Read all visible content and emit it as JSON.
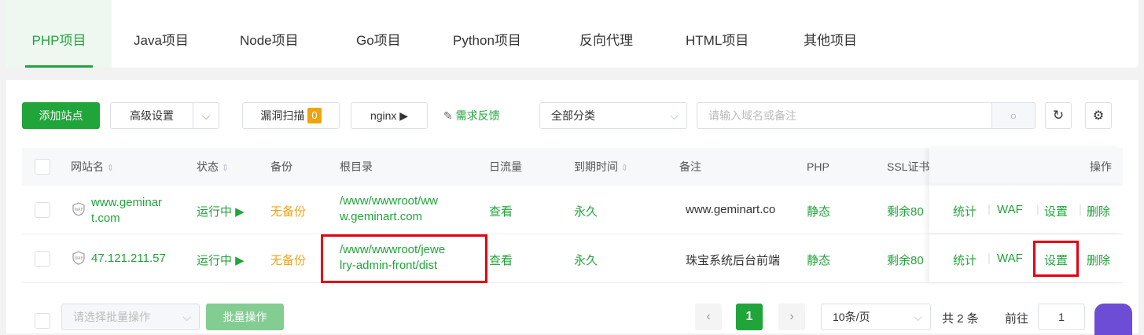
{
  "tabs": [
    "PHP项目",
    "Java项目",
    "Node项目",
    "Go项目",
    "Python项目",
    "反向代理",
    "HTML项目",
    "其他项目"
  ],
  "toolbar": {
    "add_site": "添加站点",
    "advanced": "高级设置",
    "scan": "漏洞扫描",
    "scan_count": "0",
    "nginx": "nginx ▶",
    "feedback": "需求反馈",
    "category": "全部分类",
    "search_placeholder": "请输入域名或备注"
  },
  "columns": {
    "name": "网站名",
    "status": "状态",
    "backup": "备份",
    "root": "根目录",
    "traffic": "日流量",
    "expire": "到期时间",
    "remark": "备注",
    "php": "PHP",
    "ssl": "SSL证书",
    "ops": "操作"
  },
  "rows": [
    {
      "name_l1": "www.geminar",
      "name_l2": "t.com",
      "status": "运行中 ▶",
      "backup": "无备份",
      "root_l1": "/www/wwwroot/ww",
      "root_l2": "w.geminart.com",
      "traffic": "查看",
      "expire": "永久",
      "remark": "www.geminart.co",
      "php": "静态",
      "ssl": "剩余80",
      "ops": [
        "统计",
        "WAF",
        "设置",
        "删除"
      ]
    },
    {
      "name_l1": "47.121.211.57",
      "status": "运行中 ▶",
      "backup": "无备份",
      "root_l1": "/www/wwwroot/jewe",
      "root_l2": "lry-admin-front/dist",
      "traffic": "查看",
      "expire": "永久",
      "remark": "珠宝系统后台前端",
      "php": "静态",
      "ssl": "剩余80",
      "ops": [
        "统计",
        "WAF",
        "设置",
        "删除"
      ]
    }
  ],
  "footer": {
    "batch_select": "请选择批量操作",
    "batch_btn": "批量操作",
    "page": "1",
    "per_page": "10条/页",
    "total": "共 2 条",
    "goto": "前往",
    "goto_value": "1"
  },
  "icons": {
    "waf": "waf-shield-icon",
    "search": "search-icon",
    "refresh": "refresh-icon",
    "settings": "gear-icon",
    "feedback": "edit-icon"
  },
  "colors": {
    "accent": "#20a53a",
    "warning": "#f0a30f",
    "highlight": "#e60012"
  }
}
